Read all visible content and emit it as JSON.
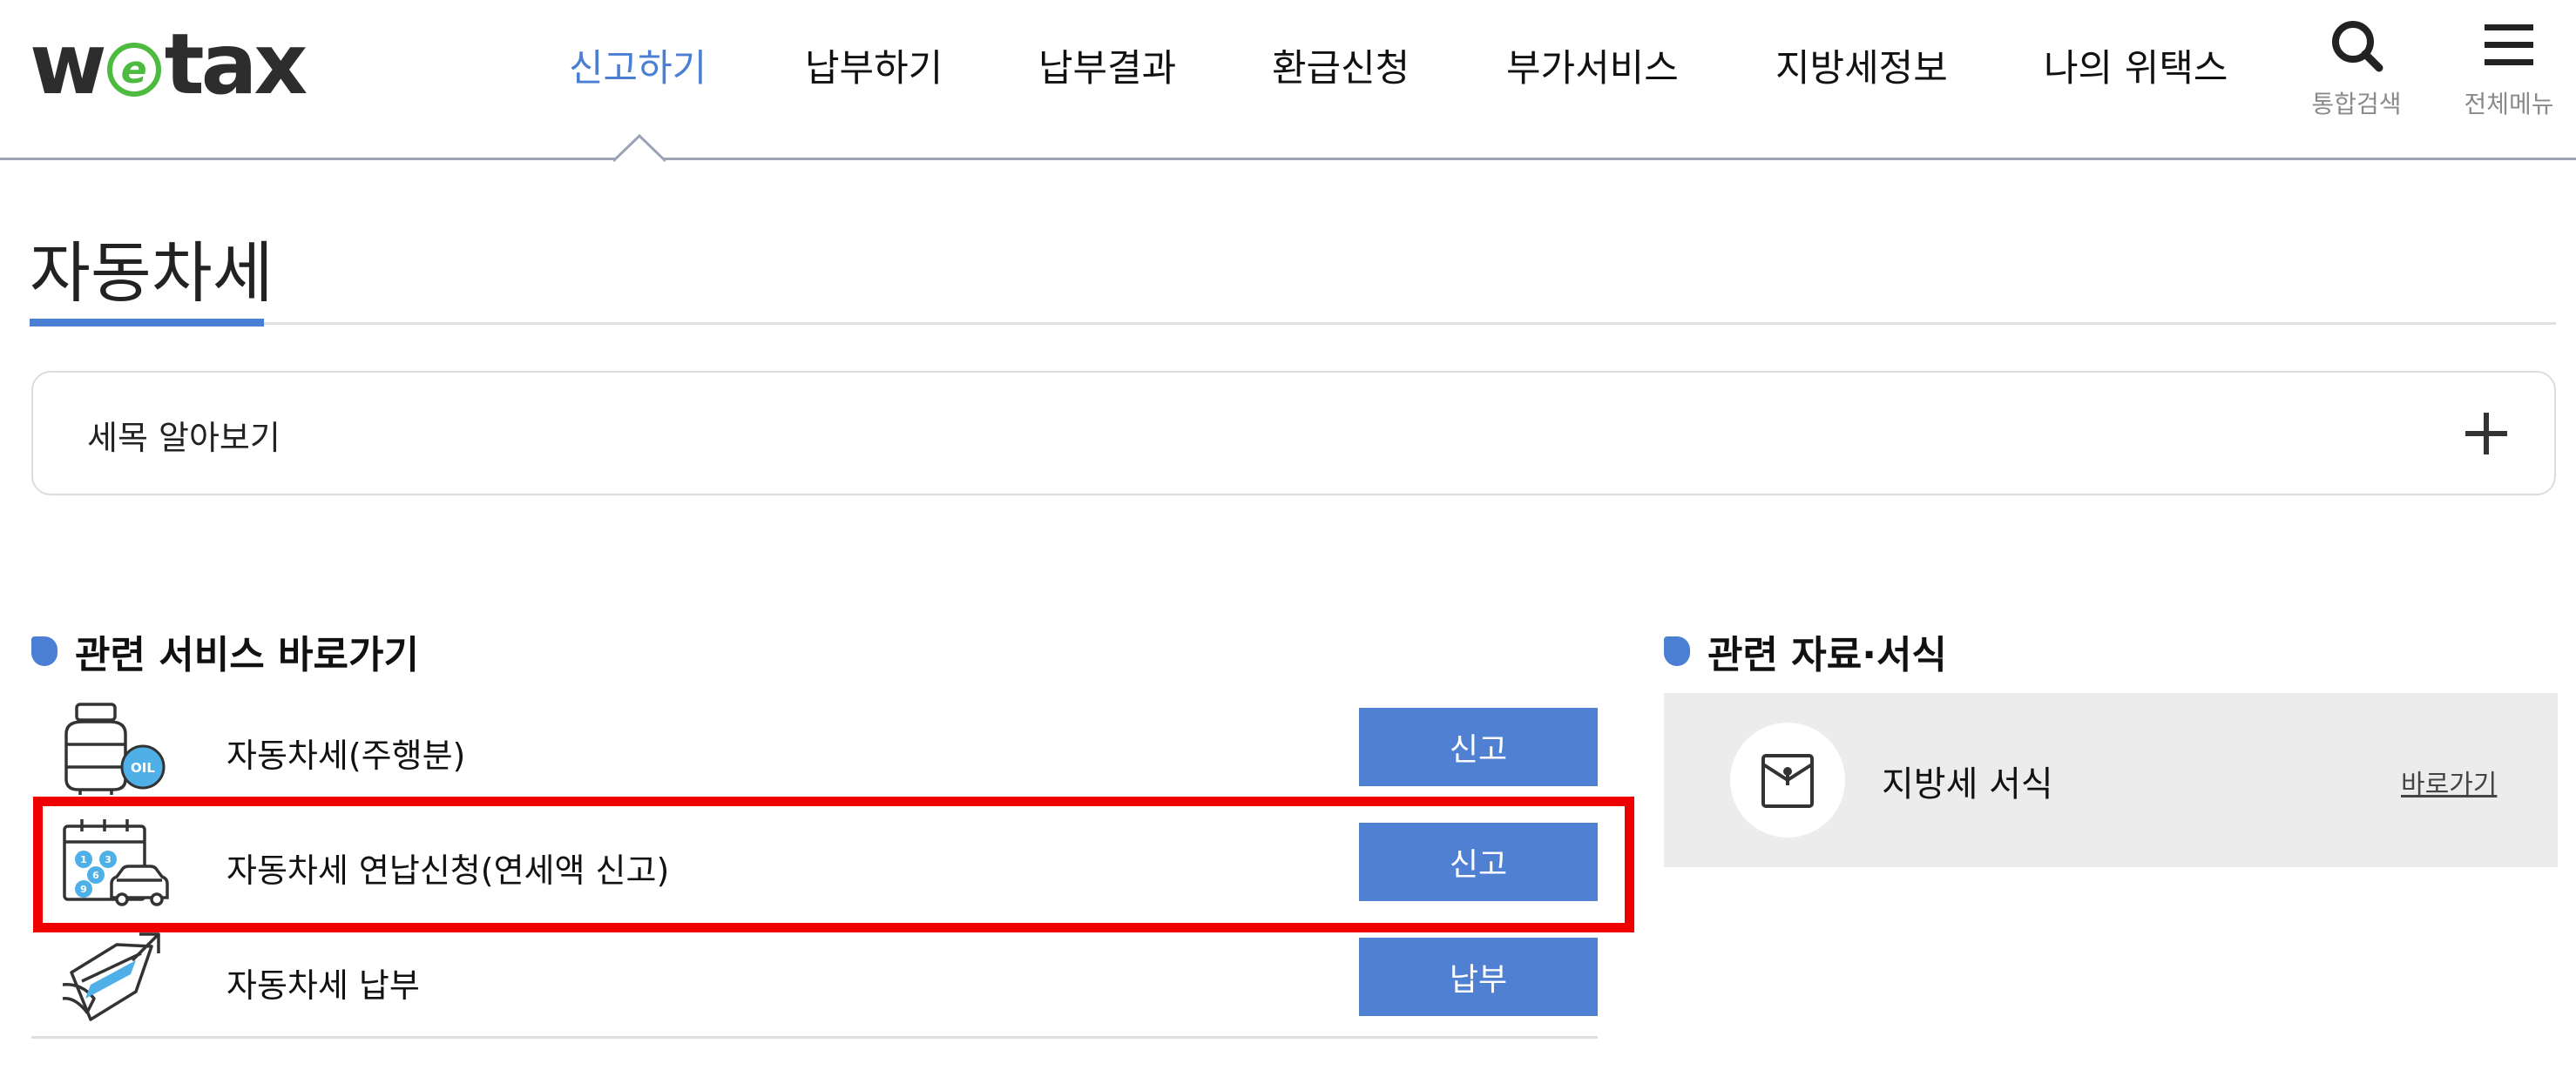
{
  "header": {
    "logo": {
      "pre": "w",
      "mid": "e",
      "post": "tax"
    },
    "nav": [
      {
        "label": "신고하기",
        "active": true
      },
      {
        "label": "납부하기",
        "active": false
      },
      {
        "label": "납부결과",
        "active": false
      },
      {
        "label": "환급신청",
        "active": false
      },
      {
        "label": "부가서비스",
        "active": false
      },
      {
        "label": "지방세정보",
        "active": false
      },
      {
        "label": "나의 위택스",
        "active": false
      }
    ],
    "search_label": "통합검색",
    "menu_label": "전체메뉴"
  },
  "page": {
    "title": "자동차세"
  },
  "accordion": {
    "label": "세목 알아보기",
    "icon": "plus-icon"
  },
  "services": {
    "title": "관련 서비스 바로가기",
    "items": [
      {
        "label": "자동차세(주행분)",
        "button": "신고",
        "icon": "fuel-tank-icon"
      },
      {
        "label": "자동차세 연납신청(연세액 신고)",
        "button": "신고",
        "icon": "calendar-car-icon",
        "highlighted": true
      },
      {
        "label": "자동차세 납부",
        "button": "납부",
        "icon": "card-payment-icon"
      }
    ]
  },
  "forms": {
    "title": "관련 자료·서식",
    "item": {
      "label": "지방세 서식",
      "link": "바로가기",
      "icon": "document-envelope-icon"
    }
  },
  "colors": {
    "accent": "#4a7fd4",
    "button": "#4f80d2",
    "highlight": "#ee0000",
    "logo_green": "#4cbb3f"
  }
}
